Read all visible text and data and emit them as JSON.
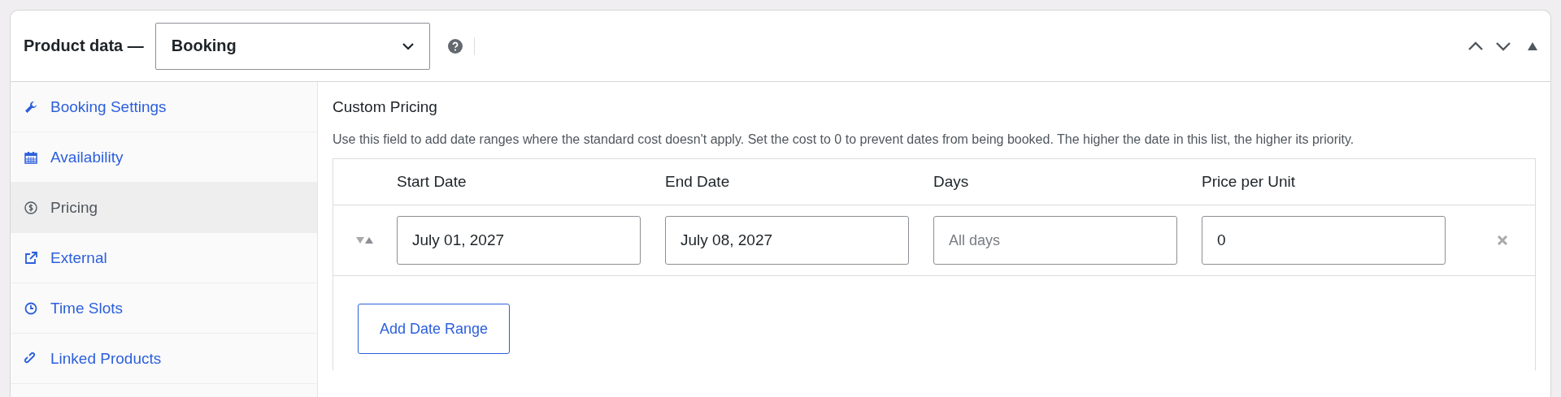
{
  "header": {
    "title": "Product data —",
    "product_type": "Booking"
  },
  "sidebar": {
    "items": [
      {
        "label": "Booking Settings",
        "kind": "wrench",
        "selected": false
      },
      {
        "label": "Availability",
        "kind": "calendar",
        "selected": false
      },
      {
        "label": "Pricing",
        "kind": "dollar",
        "selected": true
      },
      {
        "label": "External",
        "kind": "external",
        "selected": false
      },
      {
        "label": "Time Slots",
        "kind": "clock",
        "selected": false
      },
      {
        "label": "Linked Products",
        "kind": "link",
        "selected": false
      }
    ]
  },
  "section": {
    "title": "Custom Pricing",
    "description": "Use this field to add date ranges where the standard cost doesn't apply. Set the cost to 0 to prevent dates from being booked. The higher the date in this list, the higher its priority."
  },
  "table": {
    "columns": [
      "Start Date",
      "End Date",
      "Days",
      "Price per Unit"
    ],
    "rows": [
      {
        "start_date": "July 01, 2027",
        "end_date": "July 08, 2027",
        "days_placeholder": "All days",
        "price": "0"
      }
    ]
  },
  "add_button": "Add Date Range"
}
